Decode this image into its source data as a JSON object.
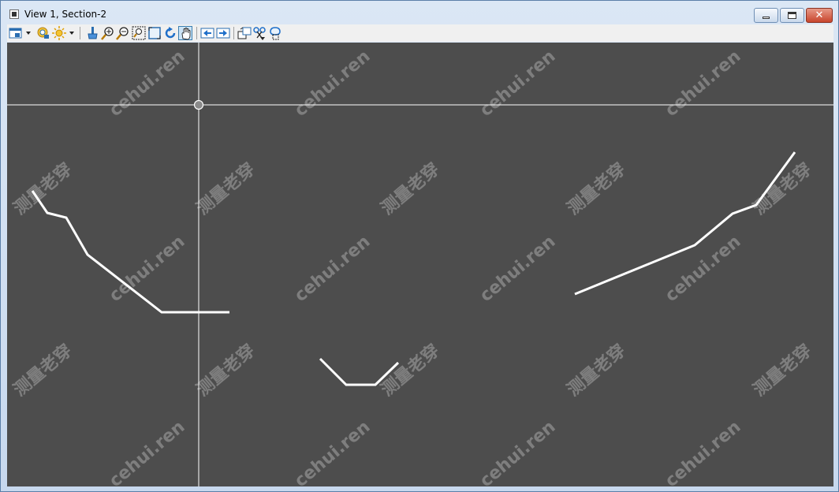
{
  "window": {
    "title": "View 1, Section-2",
    "close_glyph": "✕"
  },
  "toolbar": {
    "tools": [
      {
        "name": "view-attributes-icon"
      },
      {
        "name": "levels-display-icon"
      },
      {
        "name": "lighting-icon"
      },
      {
        "name": "update-view-icon"
      },
      {
        "name": "zoom-in-icon"
      },
      {
        "name": "zoom-out-icon"
      },
      {
        "name": "window-area-icon"
      },
      {
        "name": "fit-view-icon"
      },
      {
        "name": "rotate-view-icon"
      },
      {
        "name": "pan-view-icon",
        "active": true
      },
      {
        "name": "previous-view-icon"
      },
      {
        "name": "next-view-icon"
      },
      {
        "name": "copy-view-icon"
      },
      {
        "name": "clip-volume-icon"
      },
      {
        "name": "clip-mask-icon"
      }
    ]
  },
  "watermarks": {
    "cn": "测量老穿",
    "en": "cehui.ren"
  },
  "colors": {
    "viewport_bg": "#4d4d4d",
    "section_lines": "#ffffff",
    "crosshair": "#ffffff"
  }
}
